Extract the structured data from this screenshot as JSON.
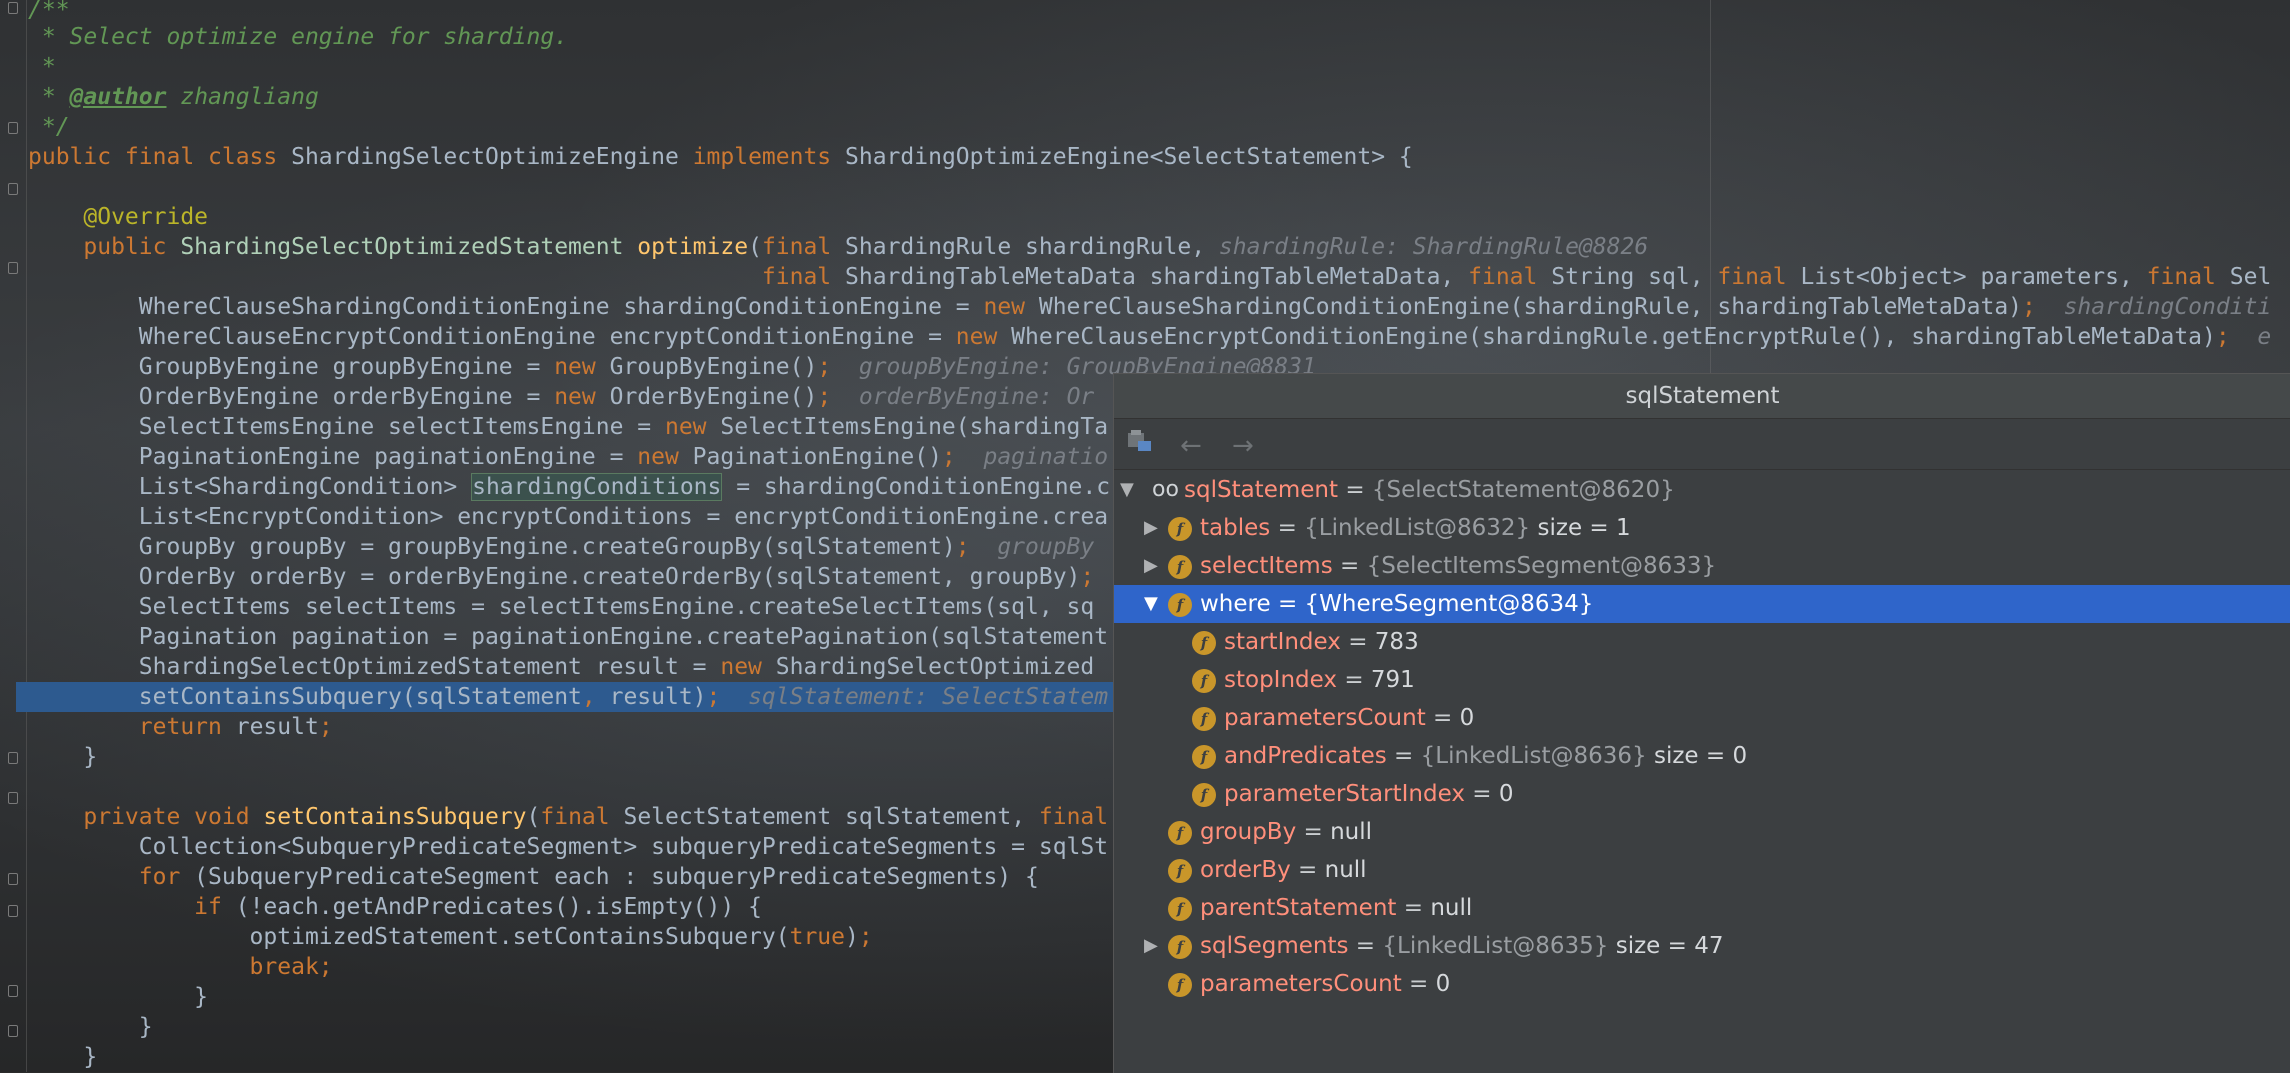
{
  "code": {
    "lines": [
      "/**",
      " * Select optimize engine for sharding.",
      " *",
      " * ",
      " */",
      "public final class ShardingSelectOptimizeEngine implements ShardingOptimizeEngine<SelectStatement> {",
      "",
      "    @Override",
      "    public ShardingSelectOptimizedStatement optimize(final ShardingRule shardingRule,",
      "                                                     final ShardingTableMetaData shardingTableMetaData, final String sql, final List<Object> parameters, final Sel",
      "        WhereClauseShardingConditionEngine shardingConditionEngine = new WhereClauseShardingConditionEngine(shardingRule, shardingTableMetaData);",
      "        WhereClauseEncryptConditionEngine encryptConditionEngine = new WhereClauseEncryptConditionEngine(shardingRule.getEncryptRule(), shardingTableMetaData);",
      "        GroupByEngine groupByEngine = new GroupByEngine();",
      "        OrderByEngine orderByEngine = new OrderByEngine();",
      "        SelectItemsEngine selectItemsEngine = new SelectItemsEngine(shardingTa",
      "        PaginationEngine paginationEngine = new PaginationEngine();",
      "        List<ShardingCondition> shardingConditions = shardingConditionEngine.c",
      "        List<EncryptCondition> encryptConditions = encryptConditionEngine.crea",
      "        GroupBy groupBy = groupByEngine.createGroupBy(sqlStatement);",
      "        OrderBy orderBy = orderByEngine.createOrderBy(sqlStatement, groupBy);",
      "        SelectItems selectItems = selectItemsEngine.createSelectItems(sql, sq",
      "        Pagination pagination = paginationEngine.createPagination(sqlStatement",
      "        ShardingSelectOptimizedStatement result = new ShardingSelectOptimized",
      "        setContainsSubquery(sqlStatement, result);",
      "        return result;",
      "    }",
      "",
      "    private void setContainsSubquery(final SelectStatement sqlStatement, final",
      "        Collection<SubqueryPredicateSegment> subqueryPredicateSegments = sqlSt",
      "        for (SubqueryPredicateSegment each : subqueryPredicateSegments) {",
      "            if (!each.getAndPredicates().isEmpty()) {",
      "                optimizedStatement.setContainsSubquery(true);",
      "                break;",
      "            }",
      "        }",
      "    }"
    ],
    "author_tag": "@author",
    "author_name": "zhangliang",
    "hints": {
      "line8": "shardingRule: ShardingRule@8826",
      "line10": "shardingConditi",
      "line11": "e",
      "line12": "groupByEngine: GroupByEngine@8831",
      "line13": "orderByEngine: Or",
      "line15": "paginatio",
      "line18": "groupBy",
      "line23": "sqlStatement: SelectStatem"
    }
  },
  "debugger": {
    "title": "sqlStatement",
    "root": {
      "name": "sqlStatement",
      "value": "{SelectStatement@8620}"
    },
    "items": [
      {
        "name": "tables",
        "value": "{LinkedList@8632}",
        "extra": "size = 1",
        "expandable": true,
        "expanded": false,
        "level": 1
      },
      {
        "name": "selectItems",
        "value": "{SelectItemsSegment@8633}",
        "extra": "",
        "expandable": true,
        "expanded": false,
        "level": 1
      },
      {
        "name": "where",
        "value": "{WhereSegment@8634}",
        "extra": "",
        "expandable": true,
        "expanded": true,
        "level": 1,
        "selected": true
      },
      {
        "name": "startIndex",
        "value": "783",
        "extra": "",
        "level": 2
      },
      {
        "name": "stopIndex",
        "value": "791",
        "extra": "",
        "level": 2
      },
      {
        "name": "parametersCount",
        "value": "0",
        "extra": "",
        "level": 2
      },
      {
        "name": "andPredicates",
        "value": "{LinkedList@8636}",
        "extra": "size = 0",
        "level": 2
      },
      {
        "name": "parameterStartIndex",
        "value": "0",
        "extra": "",
        "level": 2
      },
      {
        "name": "groupBy",
        "value": "null",
        "extra": "",
        "level": 1
      },
      {
        "name": "orderBy",
        "value": "null",
        "extra": "",
        "level": 1
      },
      {
        "name": "parentStatement",
        "value": "null",
        "extra": "",
        "level": 1
      },
      {
        "name": "sqlSegments",
        "value": "{LinkedList@8635}",
        "extra": "size = 47",
        "expandable": true,
        "expanded": false,
        "level": 1
      },
      {
        "name": "parametersCount",
        "value": "0",
        "extra": "",
        "level": 1
      }
    ],
    "toolbar": {
      "back": "←",
      "forward": "→"
    },
    "badge_letter": "f",
    "eq": "="
  }
}
